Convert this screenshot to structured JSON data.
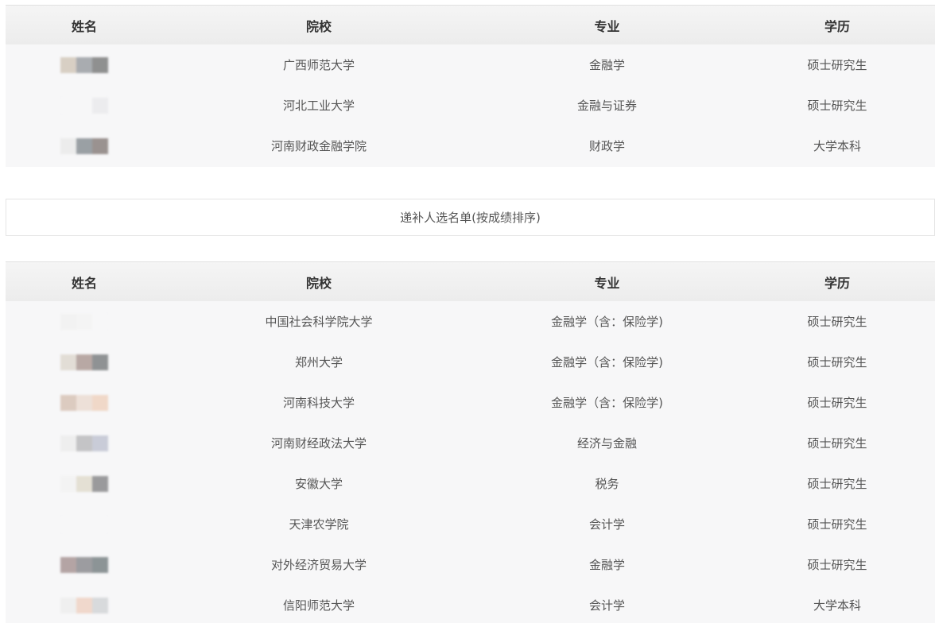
{
  "headers": {
    "name": "姓名",
    "school": "院校",
    "major": "专业",
    "degree": "学历"
  },
  "table1": [
    {
      "school": "广西师范大学",
      "major": "金融学",
      "degree": "硕士研究生",
      "name_blur": [
        "#d8cfc4",
        "#a9acb0",
        "#8f9090"
      ]
    },
    {
      "school": "河北工业大学",
      "major": "金融与证券",
      "degree": "硕士研究生",
      "name_blur": [
        "#f7f7f8",
        "#f7f7f8",
        "#ececee"
      ]
    },
    {
      "school": "河南财政金融学院",
      "major": "财政学",
      "degree": "大学本科",
      "name_blur": [
        "#ececec",
        "#9aa0a4",
        "#9a9290"
      ]
    }
  ],
  "subtitle": "递补人选名单(按成绩排序)",
  "table2": [
    {
      "school": "中国社会科学院大学",
      "major": "金融学（含：保险学)",
      "degree": "硕士研究生",
      "name_blur": [
        "#f2f2f2",
        "#f4f4f4",
        "#f7f7f8"
      ]
    },
    {
      "school": "郑州大学",
      "major": "金融学（含：保险学)",
      "degree": "硕士研究生",
      "name_blur": [
        "#e2ddd6",
        "#b8a8a4",
        "#8f9294"
      ]
    },
    {
      "school": "河南科技大学",
      "major": "金融学（含：保险学)",
      "degree": "硕士研究生",
      "name_blur": [
        "#dccbc0",
        "#ede0d8",
        "#f0d8c8"
      ]
    },
    {
      "school": "河南财经政法大学",
      "major": "经济与金融",
      "degree": "硕士研究生",
      "name_blur": [
        "#eeeeee",
        "#c4c4c6",
        "#c9ccd8"
      ]
    },
    {
      "school": "安徽大学",
      "major": "税务",
      "degree": "硕士研究生",
      "name_blur": [
        "#f3f3f3",
        "#e4e0d4",
        "#9a9a9c"
      ]
    },
    {
      "school": "天津农学院",
      "major": "会计学",
      "degree": "硕士研究生",
      "name_blur": [
        "#f7f7f8",
        "#f7f7f8",
        "#f7f7f8"
      ]
    },
    {
      "school": "对外经济贸易大学",
      "major": "金融学",
      "degree": "硕士研究生",
      "name_blur": [
        "#b4a4a4",
        "#9c9ca0",
        "#8c9496"
      ]
    },
    {
      "school": "信阳师范大学",
      "major": "会计学",
      "degree": "大学本科",
      "name_blur": [
        "#efefef",
        "#f0d8cc",
        "#d8dadc"
      ]
    }
  ]
}
